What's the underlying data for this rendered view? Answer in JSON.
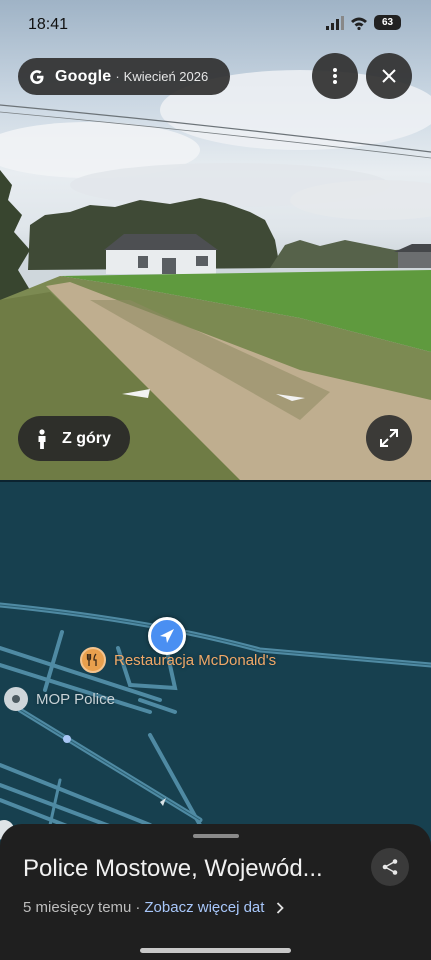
{
  "status_bar": {
    "time": "18:41",
    "battery": "63"
  },
  "streetview": {
    "brand": "Google",
    "separator": "·",
    "date": "Kwiecień 2026",
    "view_mode_label": "Z góry"
  },
  "map": {
    "pois": [
      {
        "name": "Restauracja McDonald's",
        "icon": "restaurant-icon"
      },
      {
        "name": "MOP Police",
        "icon": "place-pin-icon"
      }
    ]
  },
  "sheet": {
    "title": "Police Mostowe, Wojewód...",
    "age": "5 miesięcy temu",
    "separator": "·",
    "more_dates_link": "Zobacz więcej dat"
  },
  "colors": {
    "map_background": "#17404f",
    "road": "#4f8aa3",
    "poi_food": "#e9a04d",
    "link": "#a8c7fa",
    "location_arrow": "#4a8ff2"
  }
}
